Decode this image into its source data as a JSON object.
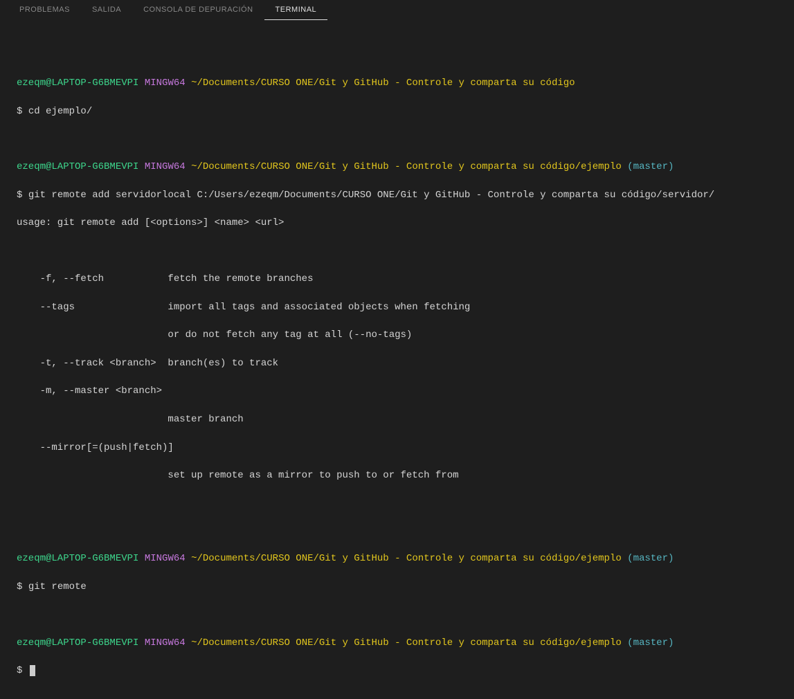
{
  "tabs": {
    "problemas": "PROBLEMAS",
    "salida": "SALIDA",
    "consola": "CONSOLA DE DEPURACIÓN",
    "terminal": "TERMINAL"
  },
  "prompt": {
    "user_host": "ezeqm@LAPTOP-G6BMEVPI",
    "shell": "MINGW64",
    "path1": "~/Documents/CURSO ONE/Git y GitHub - Controle y comparta su código",
    "path2": "~/Documents/CURSO ONE/Git y GitHub - Controle y comparta su código/ejemplo",
    "branch": "(master)",
    "dollar": "$"
  },
  "commands": {
    "cd": "cd ejemplo/",
    "git_remote_add": "git remote add servidorlocal C:/Users/ezeqm/Documents/CURSO ONE/Git y GitHub - Controle y comparta su código/servidor/",
    "git_remote": "git remote"
  },
  "output": {
    "usage": "usage: git remote add [<options>] <name> <url>",
    "opt_fetch": "    -f, --fetch           fetch the remote branches",
    "opt_tags1": "    --tags                import all tags and associated objects when fetching",
    "opt_tags2": "                          or do not fetch any tag at all (--no-tags)",
    "opt_track": "    -t, --track <branch>  branch(es) to track",
    "opt_master": "    -m, --master <branch>",
    "opt_master2": "                          master branch",
    "opt_mirror": "    --mirror[=(push|fetch)]",
    "opt_mirror2": "                          set up remote as a mirror to push to or fetch from"
  }
}
